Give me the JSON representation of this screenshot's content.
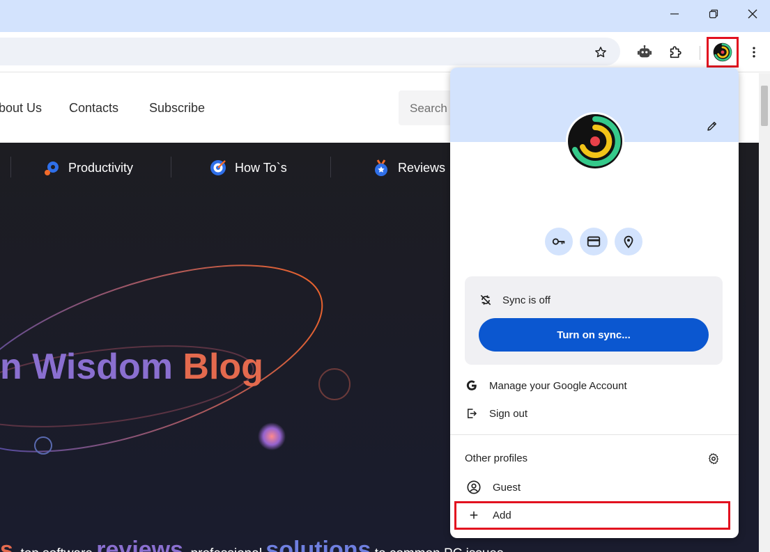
{
  "browser": {
    "window_controls": {
      "minimize_label": "—",
      "restore_label": "❐",
      "close_label": "✕"
    }
  },
  "site": {
    "nav": [
      "bout Us",
      "Contacts",
      "Subscribe"
    ],
    "search_placeholder": "Search",
    "categories": [
      "Productivity",
      "How To`s",
      "Reviews"
    ],
    "hero_title_part1": "n Wisdom",
    "hero_title_part2": "Blog",
    "hero_tagline": {
      "t1": "s",
      "t2": ", top software ",
      "t3": "reviews",
      "t4": ", professional ",
      "t5": "solutions",
      "t6": " to common PC issues"
    }
  },
  "profile_menu": {
    "sync_status": "Sync is off",
    "sync_button": "Turn on sync...",
    "manage_account": "Manage your Google Account",
    "sign_out": "Sign out",
    "other_profiles": "Other profiles",
    "guest": "Guest",
    "add": "Add"
  },
  "colors": {
    "chrome_accent": "#d3e3fd",
    "sync_button": "#0b57d0",
    "highlight": "#e2111f",
    "hero_title_purple": "#8a6fd0",
    "hero_title_orange": "#e46a4e"
  },
  "icons": {
    "toolbar": [
      "star-icon",
      "robot-extension-icon",
      "puzzle-extensions-icon",
      "profile-avatar-icon",
      "more-vert-icon"
    ],
    "menu_quick": [
      "key-icon",
      "credit-card-icon",
      "location-pin-icon"
    ]
  }
}
